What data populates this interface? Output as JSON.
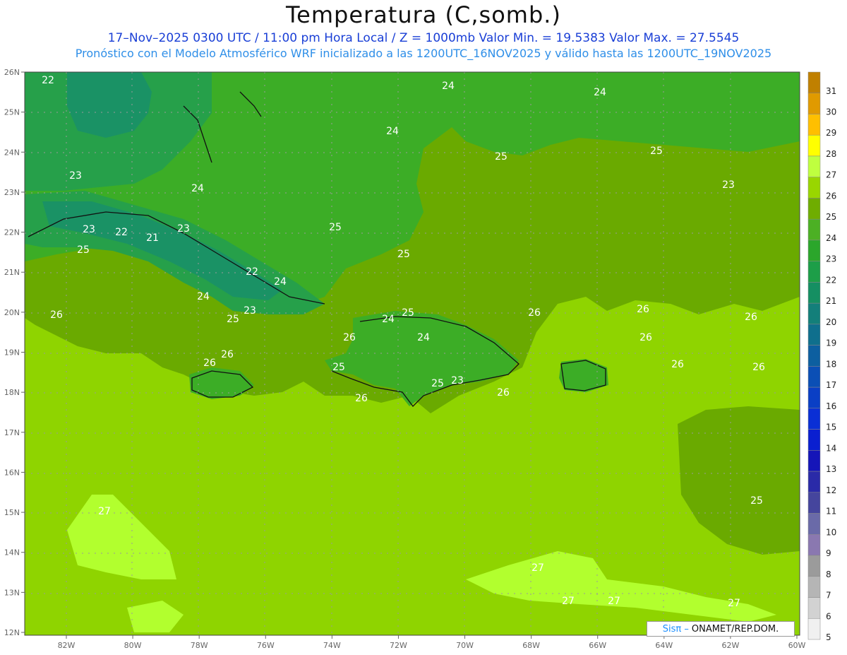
{
  "header": {
    "title": "Temperatura (C,somb.)",
    "line1": "17–Nov–2025 0300 UTC / 11:00 pm Hora Local / Z = 1000mb   Valor Min. = 19.5383   Valor Max. = 27.5545",
    "line2": "Pronóstico con el Modelo Atmosférico WRF inicializado a las 1200UTC_16NOV2025 y válido hasta las  1200UTC_19NOV2025"
  },
  "map": {
    "lat_labels": [
      "26N",
      "25N",
      "24N",
      "23N",
      "22N",
      "21N",
      "20N",
      "19N",
      "18N",
      "17N",
      "16N",
      "15N",
      "14N",
      "13N",
      "12N"
    ],
    "lon_labels": [
      "82W",
      "80W",
      "78W",
      "76W",
      "74W",
      "72W",
      "70W",
      "68W",
      "66W",
      "64W",
      "62W",
      "60W"
    ],
    "contour_labels": [
      {
        "text": "22"
      },
      {
        "text": "24"
      },
      {
        "text": "24"
      },
      {
        "text": "24"
      },
      {
        "text": "25"
      },
      {
        "text": "25"
      },
      {
        "text": "23"
      },
      {
        "text": "23"
      },
      {
        "text": "24"
      },
      {
        "text": "25"
      },
      {
        "text": "23"
      },
      {
        "text": "22"
      },
      {
        "text": "21"
      },
      {
        "text": "23"
      },
      {
        "text": "25"
      },
      {
        "text": "22"
      },
      {
        "text": "24"
      },
      {
        "text": "24"
      },
      {
        "text": "25"
      },
      {
        "text": "26"
      },
      {
        "text": "23"
      },
      {
        "text": "25"
      },
      {
        "text": "24"
      },
      {
        "text": "25"
      },
      {
        "text": "24"
      },
      {
        "text": "26"
      },
      {
        "text": "26"
      },
      {
        "text": "26"
      },
      {
        "text": "26"
      },
      {
        "text": "26"
      },
      {
        "text": "25"
      },
      {
        "text": "25"
      },
      {
        "text": "23"
      },
      {
        "text": "26"
      },
      {
        "text": "26"
      },
      {
        "text": "26"
      },
      {
        "text": "26"
      },
      {
        "text": "26"
      },
      {
        "text": "26"
      },
      {
        "text": "25"
      },
      {
        "text": "27"
      },
      {
        "text": "27"
      },
      {
        "text": "27"
      },
      {
        "text": "27"
      },
      {
        "text": "27"
      }
    ]
  },
  "colorbar": {
    "labels": [
      "31",
      "30",
      "29",
      "28",
      "27",
      "26",
      "25",
      "24",
      "23",
      "22",
      "21",
      "20",
      "19",
      "18",
      "17",
      "16",
      "15",
      "14",
      "13",
      "12",
      "11",
      "10",
      "9",
      "8",
      "7",
      "6",
      "5"
    ],
    "colors": [
      "#c08000",
      "#e09a00",
      "#ffbf00",
      "#ffff00",
      "#bfff3f",
      "#99d600",
      "#6fad00",
      "#4cb024",
      "#2ba62b",
      "#1d9e48",
      "#158f62",
      "#137f7a",
      "#0f6f8d",
      "#0d5fa0",
      "#0b4fb5",
      "#0a3fc5",
      "#0a2fd5",
      "#0a1fd0",
      "#1515b8",
      "#2a2aa8",
      "#45459d",
      "#6a6aa8",
      "#8a78b0",
      "#9b9b9b",
      "#b5b5b5",
      "#d2d2d2",
      "#f0f0f0"
    ]
  },
  "credit": {
    "sis": "Sisπ –",
    "org": "ONAMET/REP.DOM."
  }
}
